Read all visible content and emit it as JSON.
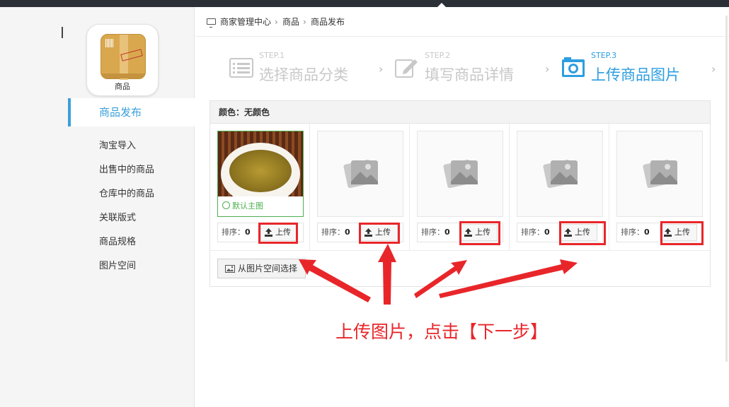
{
  "sidebar": {
    "logo_label": "商品",
    "items": [
      {
        "label": "商品发布",
        "active": true
      },
      {
        "label": "淘宝导入"
      },
      {
        "label": "出售中的商品"
      },
      {
        "label": "仓库中的商品"
      },
      {
        "label": "关联版式"
      },
      {
        "label": "商品规格"
      },
      {
        "label": "图片空间"
      }
    ]
  },
  "breadcrumb": {
    "icon": "monitor-icon",
    "items": [
      "商家管理中心",
      "商品",
      "商品发布"
    ],
    "separator": "›"
  },
  "steps": [
    {
      "num": "STEP.1",
      "title": "选择商品分类",
      "icon": "list-icon"
    },
    {
      "num": "STEP.2",
      "title": "填写商品详情",
      "icon": "edit-icon"
    },
    {
      "num": "STEP.3",
      "title": "上传商品图片",
      "icon": "camera-icon",
      "active": true
    }
  ],
  "step_arrow": "›",
  "panel": {
    "header": "颜色：无颜色",
    "main_tag": "默认主图",
    "sort_label": "排序：",
    "upload_label": "上传",
    "images": [
      {
        "type": "photo",
        "sort": "0",
        "is_main": true
      },
      {
        "type": "placeholder",
        "sort": "0"
      },
      {
        "type": "placeholder",
        "sort": "0"
      },
      {
        "type": "placeholder",
        "sort": "0"
      },
      {
        "type": "placeholder",
        "sort": "0"
      }
    ],
    "from_space_label": "从图片空间选择"
  },
  "annotation": {
    "text": "上传图片，点击【下一步】",
    "color": "#e8262a"
  },
  "colors": {
    "accent": "#2d9ee0",
    "success": "#4caf50",
    "annotation": "#e8262a"
  }
}
